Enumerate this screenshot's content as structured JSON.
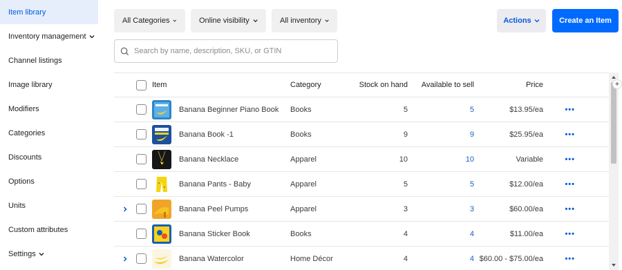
{
  "sidebar": {
    "items": [
      {
        "label": "Item library",
        "active": true
      },
      {
        "label": "Inventory management",
        "has_chevron": true
      },
      {
        "label": "Channel listings"
      },
      {
        "label": "Image library"
      },
      {
        "label": "Modifiers"
      },
      {
        "label": "Categories"
      },
      {
        "label": "Discounts"
      },
      {
        "label": "Options"
      },
      {
        "label": "Units"
      },
      {
        "label": "Custom attributes"
      },
      {
        "label": "Settings",
        "has_chevron": true
      }
    ]
  },
  "filters": {
    "categories": "All Categories",
    "visibility": "Online visibility",
    "inventory": "All inventory"
  },
  "actions_label": "Actions",
  "create_label": "Create an Item",
  "search": {
    "placeholder": "Search by name, description, SKU, or GTIN",
    "value": ""
  },
  "table": {
    "headers": {
      "item": "Item",
      "category": "Category",
      "stock": "Stock on hand",
      "available": "Available to sell",
      "price": "Price"
    },
    "rows": [
      {
        "name": "Banana Beginner Piano Book",
        "category": "Books",
        "stock": "5",
        "available": "5",
        "price": "$13.95/ea",
        "expandable": false,
        "thumb": "book-yellow"
      },
      {
        "name": "Banana Book -1",
        "category": "Books",
        "stock": "9",
        "available": "9",
        "price": "$25.95/ea",
        "expandable": false,
        "thumb": "book-blue"
      },
      {
        "name": "Banana Necklace",
        "category": "Apparel",
        "stock": "10",
        "available": "10",
        "price": "Variable",
        "expandable": false,
        "thumb": "necklace"
      },
      {
        "name": "Banana Pants - Baby",
        "category": "Apparel",
        "stock": "5",
        "available": "5",
        "price": "$12.00/ea",
        "expandable": false,
        "thumb": "pants"
      },
      {
        "name": "Banana Peel Pumps",
        "category": "Apparel",
        "stock": "3",
        "available": "3",
        "price": "$60.00/ea",
        "expandable": true,
        "thumb": "pumps"
      },
      {
        "name": "Banana Sticker Book",
        "category": "Books",
        "stock": "4",
        "available": "4",
        "price": "$11.00/ea",
        "expandable": false,
        "thumb": "sticker-book"
      },
      {
        "name": "Banana Watercolor",
        "category": "Home Décor",
        "stock": "4",
        "available": "4",
        "price": "$60.00 - $75.00/ea",
        "expandable": true,
        "thumb": "watercolor"
      }
    ],
    "row_menu": "•••"
  },
  "colors": {
    "accent": "#006aff",
    "link": "#005ad9",
    "active_bg": "#e6eefc"
  }
}
